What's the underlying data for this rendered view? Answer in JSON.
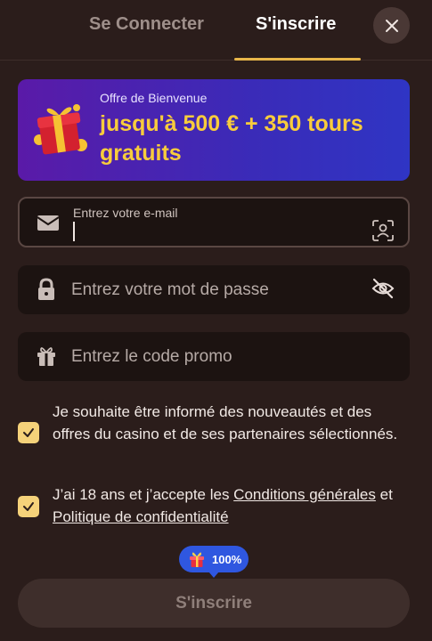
{
  "tabs": {
    "login_label": "Se Connecter",
    "register_label": "S'inscrire"
  },
  "banner": {
    "label": "Offre de Bienvenue",
    "headline": "jusqu'à 500 € + 350 tours gratuits",
    "icon": "gift-icon"
  },
  "form": {
    "email": {
      "label": "Entrez votre e-mail",
      "value": "",
      "icon": "envelope-icon",
      "trailing_icon": "face-scan-icon"
    },
    "password": {
      "placeholder": "Entrez votre mot de passe",
      "icon": "lock-icon",
      "trailing_icon": "eye-off-icon"
    },
    "promo": {
      "placeholder": "Entrez le code promo",
      "icon": "gift-icon"
    }
  },
  "consents": {
    "newsletter": {
      "checked": true,
      "text": "Je souhaite être informé des nouveautés et des offres du casino et de ses partenaires sélectionnés."
    },
    "terms": {
      "checked": true,
      "prefix": "J’ai 18 ans et j’accepte les ",
      "terms_link": "Conditions générales",
      "conjunction": " et ",
      "privacy_link": "Politique de confidentialité"
    }
  },
  "progress_badge": {
    "value": "100%",
    "icon": "gift-icon"
  },
  "submit_label": "S'inscrire",
  "colors": {
    "background": "#2b1d1b",
    "accent": "#e8b64a",
    "headline": "#f8cc3c",
    "checkbox": "#f5d27a",
    "badge": "#2f57e0"
  }
}
